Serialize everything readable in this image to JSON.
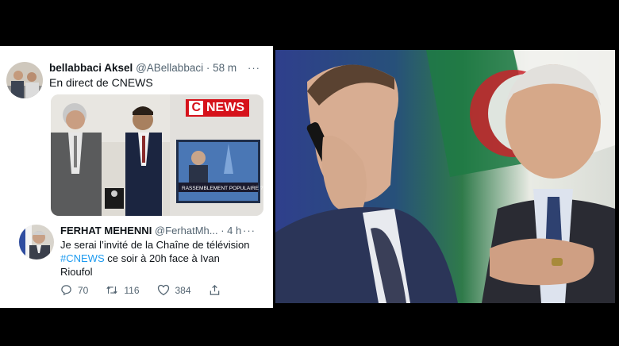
{
  "tweet": {
    "display_name": "bellabbaci Aksel",
    "handle": "@ABellabbaci",
    "time": "· 58 m",
    "more": "···",
    "text": "En direct de CNEWS",
    "media": {
      "logo_c": "C",
      "logo_text": "NEWS",
      "tv_banner": "RASSEMBLEMENT POPULAIRE ?"
    }
  },
  "quoted": {
    "display_name": "FERHAT MEHENNI",
    "handle": "@FerhatMh...",
    "time": "· 4 h",
    "more": "···",
    "text_line1": "Je serai l’invité de la Chaîne de télévision",
    "hashtag": "#CNEWS",
    "text_line2_rest": " ce soir à 20h  face à Ivan",
    "text_line3": "Rioufol",
    "reply_count": "70",
    "retweet_count": "116",
    "like_count": "384"
  },
  "colors": {
    "hashtag": "#1d9bf0",
    "cnews_red": "#d6121b",
    "muted_text": "#536471"
  },
  "icons": [
    "reply-icon",
    "retweet-icon",
    "like-icon",
    "share-icon",
    "more-icon"
  ]
}
